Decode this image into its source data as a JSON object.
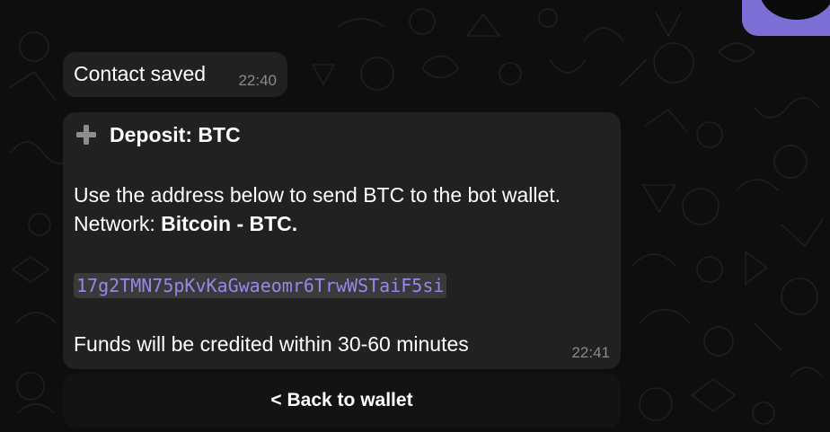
{
  "messages": [
    {
      "text": "Contact saved",
      "time": "22:40"
    },
    {
      "title": "Deposit: BTC",
      "body_line_1": "Use the address below to send BTC to the bot wallet.",
      "network_label": "Network: ",
      "network_value": "Bitcoin - BTC.",
      "address": "17g2TMN75pKvKaGwaeomr6TrwWSTaiF5si",
      "body_line_4": "Funds will be credited within 30-60 minutes",
      "time": "22:41"
    }
  ],
  "keyboard": {
    "back_button_label": "< Back to wallet"
  },
  "colors": {
    "background": "#0e0e0e",
    "bubble": "#212121",
    "accent": "#7b6fd6",
    "address_text": "#9a86e8",
    "timestamp": "#8a8a8a"
  },
  "icons": {
    "deposit_title_icon": "plus-icon"
  }
}
